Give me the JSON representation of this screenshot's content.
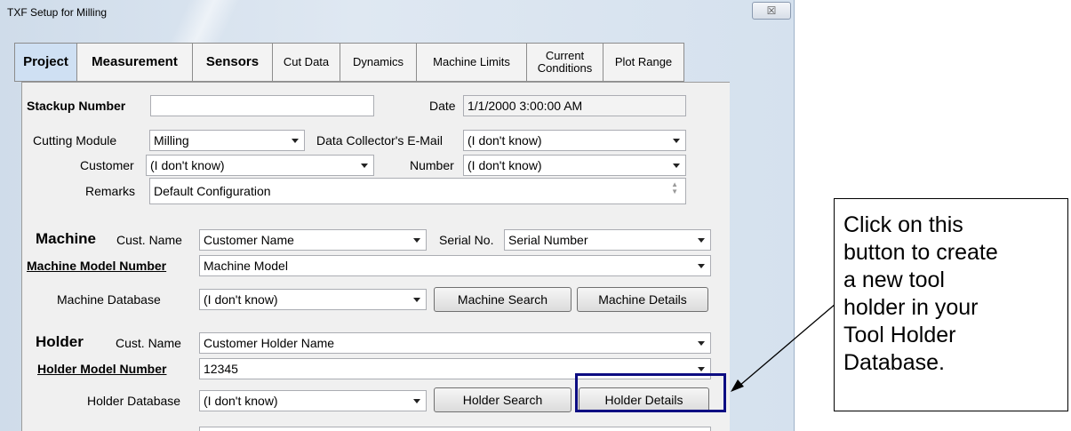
{
  "window": {
    "title": "TXF Setup for Milling",
    "close_glyph": "☒"
  },
  "tabs": [
    {
      "label": "Project"
    },
    {
      "label": "Measurement"
    },
    {
      "label": "Sensors"
    },
    {
      "label": "Cut Data"
    },
    {
      "label": "Dynamics"
    },
    {
      "label": "Machine Limits"
    },
    {
      "label": "Current Conditions"
    },
    {
      "label": "Plot Range"
    }
  ],
  "project": {
    "stackup_label": "Stackup Number",
    "stackup_value": "",
    "date_label": "Date",
    "date_value": "1/1/2000 3:00:00 AM",
    "cutting_module_label": "Cutting Module",
    "cutting_module_value": "Milling",
    "email_label": "Data Collector's E-Mail",
    "email_value": "(I don't know)",
    "customer_label": "Customer",
    "customer_value": "(I don't know)",
    "number_label": "Number",
    "number_value": "(I don't know)",
    "remarks_label": "Remarks",
    "remarks_value": "Default Configuration"
  },
  "machine": {
    "heading": "Machine",
    "cust_name_label": "Cust. Name",
    "cust_name_value": "Customer Name",
    "serial_label": "Serial No.",
    "serial_value": "Serial Number",
    "model_label": "Machine Model Number",
    "model_value": "Machine Model",
    "database_label": "Machine Database",
    "database_value": "(I don't know)",
    "search_button": "Machine Search",
    "details_button": "Machine Details"
  },
  "holder": {
    "heading": "Holder",
    "cust_name_label": "Cust. Name",
    "cust_name_value": "Customer Holder Name",
    "model_label": "Holder Model Number",
    "model_value": "12345",
    "database_label": "Holder Database",
    "database_value": "(I don't know)",
    "search_button": "Holder Search",
    "details_button": "Holder Details"
  },
  "callout": {
    "lines": [
      "Click on this",
      "button to create",
      "a new tool",
      "holder in your",
      "Tool Holder",
      "Database."
    ]
  },
  "colors": {
    "highlight_border": "#0d0d82",
    "active_tab": "#cfe0f3"
  }
}
